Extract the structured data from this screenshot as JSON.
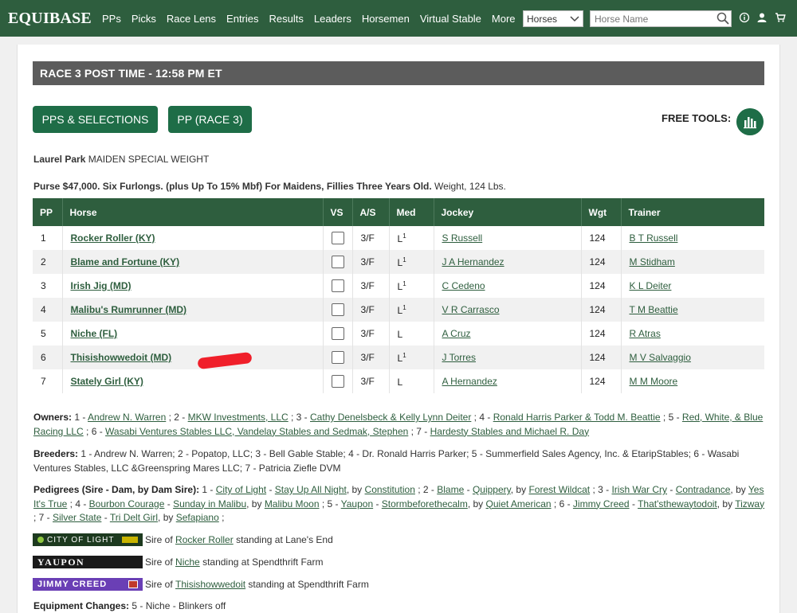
{
  "nav": {
    "logo": "EQUIBASE",
    "links": [
      "PPs",
      "Picks",
      "Race Lens",
      "Entries",
      "Results",
      "Leaders",
      "Horsemen",
      "Virtual Stable",
      "More"
    ],
    "search_type": "Horses",
    "search_placeholder": "Horse Name"
  },
  "race_header": "RACE 3 POST TIME - 12:58 PM ET",
  "buttons": {
    "pps_selections": "PPS & SELECTIONS",
    "pp_race": "PP (RACE 3)"
  },
  "free_tools": "FREE TOOLS:",
  "track": {
    "name": "Laurel Park",
    "race_type": "MAIDEN SPECIAL WEIGHT"
  },
  "purse": {
    "conditions": "Purse $47,000. Six Furlongs. (plus Up To 15% Mbf) For Maidens, Fillies Three Years Old.",
    "weight": "Weight, 124 Lbs."
  },
  "table": {
    "headers": [
      "PP",
      "Horse",
      "VS",
      "A/S",
      "Med",
      "Jockey",
      "Wgt",
      "Trainer"
    ],
    "rows": [
      {
        "pp": "1",
        "horse": "Rocker Roller (KY)",
        "as": "3/F",
        "med": "L",
        "med_sup": "1",
        "jockey": "S Russell",
        "wgt": "124",
        "trainer": "B T Russell"
      },
      {
        "pp": "2",
        "horse": "Blame and Fortune (KY)",
        "as": "3/F",
        "med": "L",
        "med_sup": "1",
        "jockey": "J A Hernandez",
        "wgt": "124",
        "trainer": "M Stidham"
      },
      {
        "pp": "3",
        "horse": "Irish Jig (MD)",
        "as": "3/F",
        "med": "L",
        "med_sup": "1",
        "jockey": "C Cedeno",
        "wgt": "124",
        "trainer": "K L Deiter"
      },
      {
        "pp": "4",
        "horse": "Malibu's Rumrunner (MD)",
        "as": "3/F",
        "med": "L",
        "med_sup": "1",
        "jockey": "V R Carrasco",
        "wgt": "124",
        "trainer": "T M Beattie"
      },
      {
        "pp": "5",
        "horse": "Niche (FL)",
        "as": "3/F",
        "med": "L",
        "med_sup": "",
        "jockey": "A Cruz",
        "wgt": "124",
        "trainer": "R Atras"
      },
      {
        "pp": "6",
        "horse": "Thisishowwedoit (MD)",
        "as": "3/F",
        "med": "L",
        "med_sup": "1",
        "jockey": "J Torres",
        "wgt": "124",
        "trainer": "M V Salvaggio"
      },
      {
        "pp": "7",
        "horse": "Stately Girl (KY)",
        "as": "3/F",
        "med": "L",
        "med_sup": "",
        "jockey": "A Hernandez",
        "wgt": "124",
        "trainer": "M M Moore"
      }
    ]
  },
  "owners": {
    "label": "Owners:",
    "items": [
      {
        "n": "1",
        "name": "Andrew N. Warren"
      },
      {
        "n": "2",
        "name": "MKW Investments, LLC"
      },
      {
        "n": "3",
        "name": "Cathy Denelsbeck & Kelly Lynn Deiter"
      },
      {
        "n": "4",
        "name": "Ronald Harris Parker & Todd M. Beattie"
      },
      {
        "n": "5",
        "name": "Red, White, & Blue Racing LLC"
      },
      {
        "n": "6",
        "name": "Wasabi Ventures Stables LLC, Vandelay Stables and Sedmak, Stephen"
      },
      {
        "n": "7",
        "name": "Hardesty Stables and Michael R. Day"
      }
    ]
  },
  "breeders": {
    "label": "Breeders:",
    "text": "1 - Andrew N. Warren; 2 - Popatop, LLC; 3 - Bell Gable Stable; 4 - Dr. Ronald Harris Parker; 5 - Summerfield Sales Agency, Inc. & EtaripStables; 6 - Wasabi Ventures Stables, LLC &Greenspring Mares LLC; 7 - Patricia Ziefle DVM"
  },
  "pedigrees": {
    "label": "Pedigrees (Sire - Dam, by Dam Sire):",
    "items": [
      {
        "n": "1",
        "sire": "City of Light",
        "dam": "Stay Up All Night",
        "damsire": "Constitution"
      },
      {
        "n": "2",
        "sire": "Blame",
        "dam": "Quippery",
        "damsire": "Forest Wildcat"
      },
      {
        "n": "3",
        "sire": "Irish War Cry",
        "dam": "Contradance",
        "damsire": "Yes It's True"
      },
      {
        "n": "4",
        "sire": "Bourbon Courage",
        "dam": "Sunday in Malibu",
        "damsire": "Malibu Moon"
      },
      {
        "n": "5",
        "sire": "Yaupon",
        "dam": "Stormbeforethecalm",
        "damsire": "Quiet American"
      },
      {
        "n": "6",
        "sire": "Jimmy Creed",
        "dam": "That'sthewaytodoit",
        "damsire": "Tizway"
      },
      {
        "n": "7",
        "sire": "Silver State",
        "dam": "Tri Delt Girl",
        "damsire": "Sefapiano"
      }
    ]
  },
  "sire_ads": [
    {
      "banner": "CITY OF LIGHT",
      "text_pre": "Sire of",
      "horse": "Rocker Roller",
      "text_post": "standing at Lane's End",
      "color": "#1d3a1f"
    },
    {
      "banner": "YAUPON",
      "text_pre": "Sire of",
      "horse": "Niche",
      "text_post": "standing at Spendthrift Farm",
      "color": "#1a1a1a"
    },
    {
      "banner": "JIMMY CREED",
      "text_pre": "Sire of",
      "horse": "Thisishowwedoit",
      "text_post": "standing at Spendthrift Farm",
      "color": "#6a3fb5"
    }
  ],
  "equipment": {
    "label": "Equipment Changes:",
    "text": "5 - Niche - Blinkers off"
  },
  "colors": {
    "nav_green": "#2e5e3e",
    "button_green": "#1e6d47",
    "header_gray": "#5c5c5c",
    "redaction": "#f01f2a"
  }
}
